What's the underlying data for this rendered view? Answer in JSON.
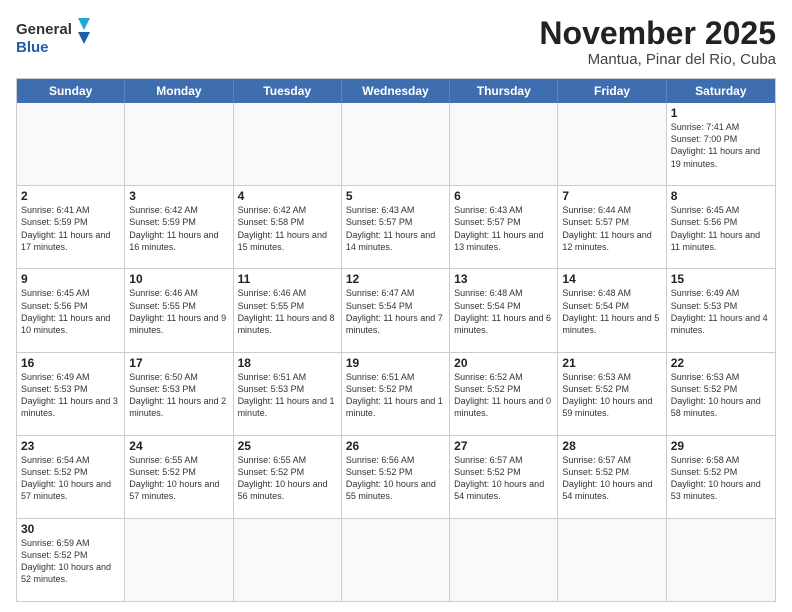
{
  "header": {
    "logo_general": "General",
    "logo_blue": "Blue",
    "month_year": "November 2025",
    "location": "Mantua, Pinar del Rio, Cuba"
  },
  "days_of_week": [
    "Sunday",
    "Monday",
    "Tuesday",
    "Wednesday",
    "Thursday",
    "Friday",
    "Saturday"
  ],
  "weeks": [
    [
      {
        "day": "",
        "info": ""
      },
      {
        "day": "",
        "info": ""
      },
      {
        "day": "",
        "info": ""
      },
      {
        "day": "",
        "info": ""
      },
      {
        "day": "",
        "info": ""
      },
      {
        "day": "",
        "info": ""
      },
      {
        "day": "1",
        "info": "Sunrise: 7:41 AM\nSunset: 7:00 PM\nDaylight: 11 hours and 19 minutes."
      }
    ],
    [
      {
        "day": "2",
        "info": "Sunrise: 6:41 AM\nSunset: 5:59 PM\nDaylight: 11 hours and 17 minutes."
      },
      {
        "day": "3",
        "info": "Sunrise: 6:42 AM\nSunset: 5:59 PM\nDaylight: 11 hours and 16 minutes."
      },
      {
        "day": "4",
        "info": "Sunrise: 6:42 AM\nSunset: 5:58 PM\nDaylight: 11 hours and 15 minutes."
      },
      {
        "day": "5",
        "info": "Sunrise: 6:43 AM\nSunset: 5:57 PM\nDaylight: 11 hours and 14 minutes."
      },
      {
        "day": "6",
        "info": "Sunrise: 6:43 AM\nSunset: 5:57 PM\nDaylight: 11 hours and 13 minutes."
      },
      {
        "day": "7",
        "info": "Sunrise: 6:44 AM\nSunset: 5:57 PM\nDaylight: 11 hours and 12 minutes."
      },
      {
        "day": "8",
        "info": "Sunrise: 6:45 AM\nSunset: 5:56 PM\nDaylight: 11 hours and 11 minutes."
      }
    ],
    [
      {
        "day": "9",
        "info": "Sunrise: 6:45 AM\nSunset: 5:56 PM\nDaylight: 11 hours and 10 minutes."
      },
      {
        "day": "10",
        "info": "Sunrise: 6:46 AM\nSunset: 5:55 PM\nDaylight: 11 hours and 9 minutes."
      },
      {
        "day": "11",
        "info": "Sunrise: 6:46 AM\nSunset: 5:55 PM\nDaylight: 11 hours and 8 minutes."
      },
      {
        "day": "12",
        "info": "Sunrise: 6:47 AM\nSunset: 5:54 PM\nDaylight: 11 hours and 7 minutes."
      },
      {
        "day": "13",
        "info": "Sunrise: 6:48 AM\nSunset: 5:54 PM\nDaylight: 11 hours and 6 minutes."
      },
      {
        "day": "14",
        "info": "Sunrise: 6:48 AM\nSunset: 5:54 PM\nDaylight: 11 hours and 5 minutes."
      },
      {
        "day": "15",
        "info": "Sunrise: 6:49 AM\nSunset: 5:53 PM\nDaylight: 11 hours and 4 minutes."
      }
    ],
    [
      {
        "day": "16",
        "info": "Sunrise: 6:49 AM\nSunset: 5:53 PM\nDaylight: 11 hours and 3 minutes."
      },
      {
        "day": "17",
        "info": "Sunrise: 6:50 AM\nSunset: 5:53 PM\nDaylight: 11 hours and 2 minutes."
      },
      {
        "day": "18",
        "info": "Sunrise: 6:51 AM\nSunset: 5:53 PM\nDaylight: 11 hours and 1 minute."
      },
      {
        "day": "19",
        "info": "Sunrise: 6:51 AM\nSunset: 5:52 PM\nDaylight: 11 hours and 1 minute."
      },
      {
        "day": "20",
        "info": "Sunrise: 6:52 AM\nSunset: 5:52 PM\nDaylight: 11 hours and 0 minutes."
      },
      {
        "day": "21",
        "info": "Sunrise: 6:53 AM\nSunset: 5:52 PM\nDaylight: 10 hours and 59 minutes."
      },
      {
        "day": "22",
        "info": "Sunrise: 6:53 AM\nSunset: 5:52 PM\nDaylight: 10 hours and 58 minutes."
      }
    ],
    [
      {
        "day": "23",
        "info": "Sunrise: 6:54 AM\nSunset: 5:52 PM\nDaylight: 10 hours and 57 minutes."
      },
      {
        "day": "24",
        "info": "Sunrise: 6:55 AM\nSunset: 5:52 PM\nDaylight: 10 hours and 57 minutes."
      },
      {
        "day": "25",
        "info": "Sunrise: 6:55 AM\nSunset: 5:52 PM\nDaylight: 10 hours and 56 minutes."
      },
      {
        "day": "26",
        "info": "Sunrise: 6:56 AM\nSunset: 5:52 PM\nDaylight: 10 hours and 55 minutes."
      },
      {
        "day": "27",
        "info": "Sunrise: 6:57 AM\nSunset: 5:52 PM\nDaylight: 10 hours and 54 minutes."
      },
      {
        "day": "28",
        "info": "Sunrise: 6:57 AM\nSunset: 5:52 PM\nDaylight: 10 hours and 54 minutes."
      },
      {
        "day": "29",
        "info": "Sunrise: 6:58 AM\nSunset: 5:52 PM\nDaylight: 10 hours and 53 minutes."
      }
    ],
    [
      {
        "day": "30",
        "info": "Sunrise: 6:59 AM\nSunset: 5:52 PM\nDaylight: 10 hours and 52 minutes."
      },
      {
        "day": "",
        "info": ""
      },
      {
        "day": "",
        "info": ""
      },
      {
        "day": "",
        "info": ""
      },
      {
        "day": "",
        "info": ""
      },
      {
        "day": "",
        "info": ""
      },
      {
        "day": "",
        "info": ""
      }
    ]
  ]
}
